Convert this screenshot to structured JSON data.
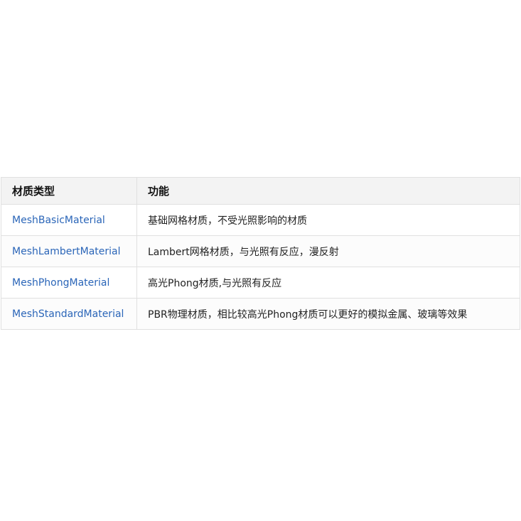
{
  "table": {
    "headers": {
      "type": "材质类型",
      "function": "功能"
    },
    "rows": [
      {
        "type": "MeshBasicMaterial",
        "function": "基础网格材质，不受光照影响的材质"
      },
      {
        "type": "MeshLambertMaterial",
        "function": "Lambert网格材质，与光照有反应，漫反射"
      },
      {
        "type": "MeshPhongMaterial",
        "function": "高光Phong材质,与光照有反应"
      },
      {
        "type": "MeshStandardMaterial",
        "function": "PBR物理材质，相比较高光Phong材质可以更好的模拟金属、玻璃等效果"
      }
    ],
    "colors": {
      "link": "#2a65b8",
      "header_bg": "#f3f3f3",
      "border": "#e0e0e0"
    }
  }
}
